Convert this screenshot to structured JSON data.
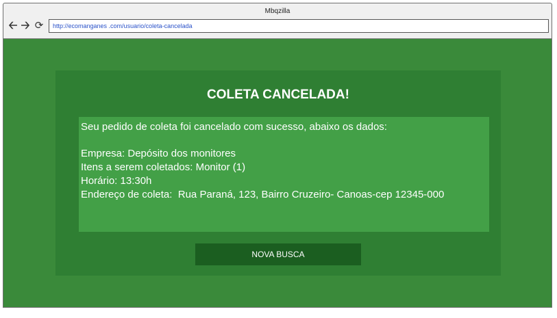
{
  "browser": {
    "window_title": "Mbqzilla",
    "url": "http://ecomanganes .com/usuario/coleta-cancelada",
    "icons": {
      "back": "back-arrow-icon",
      "forward": "forward-arrow-icon",
      "reload": "reload-icon"
    }
  },
  "page": {
    "title": "COLETA CANCELADA!",
    "message": "Seu pedido de coleta foi cancelado com sucesso, abaixo os dados:",
    "details": {
      "empresa": "Empresa: Depósito dos monitores",
      "itens": "Itens a serem coletados: Monitor (1)",
      "horario": "Horário: 13:30h",
      "endereco": "Endereço de coleta:  Rua Paraná, 123, Bairro Cruzeiro- Canoas-cep 12345-000"
    },
    "button_label": "NOVA BUSCA"
  },
  "colors": {
    "page_background": "#3a8a3a",
    "panel_background": "#2f7f33",
    "info_box_background": "#43a047",
    "button_background": "#1b5e20",
    "text": "#ffffff"
  }
}
